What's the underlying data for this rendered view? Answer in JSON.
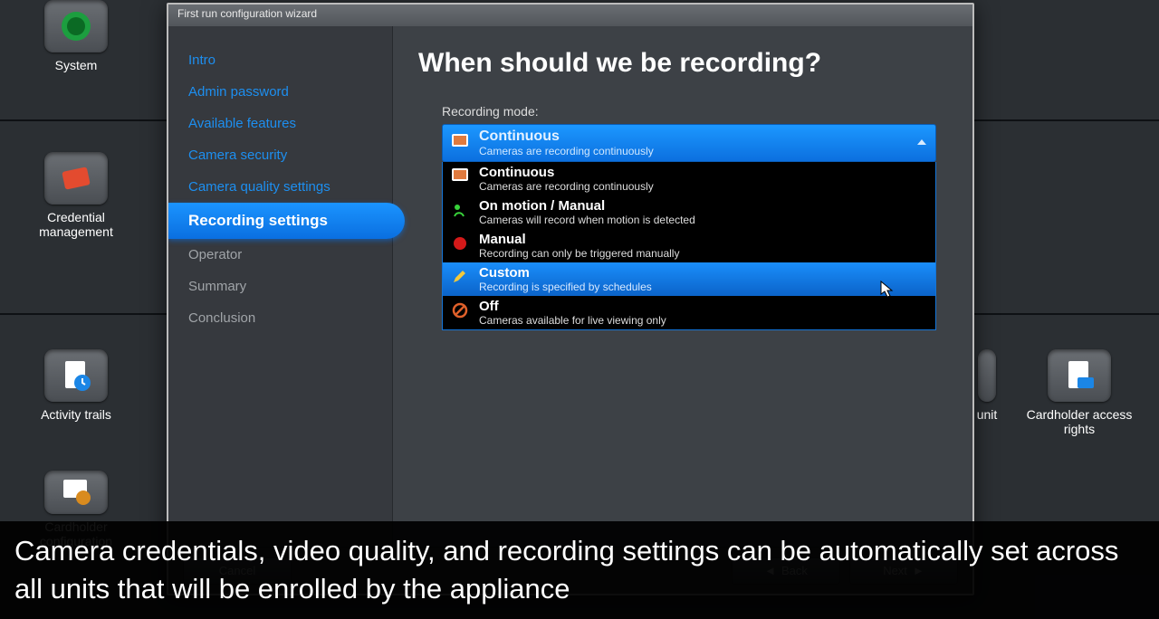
{
  "desktop": {
    "icons": [
      {
        "label": "System"
      },
      {
        "label": "Credential management"
      },
      {
        "label": "Activity trails"
      },
      {
        "label": "Cardholder configuration"
      },
      {
        "label_right_partial": "unit"
      },
      {
        "label_right": "Cardholder access rights"
      }
    ]
  },
  "wizard": {
    "title": "First run configuration wizard",
    "sidebar": [
      {
        "label": "Intro",
        "state": "link"
      },
      {
        "label": "Admin password",
        "state": "link"
      },
      {
        "label": "Available features",
        "state": "link"
      },
      {
        "label": "Camera security",
        "state": "link"
      },
      {
        "label": "Camera quality settings",
        "state": "link"
      },
      {
        "label": "Recording settings",
        "state": "active"
      },
      {
        "label": "Operator",
        "state": "done"
      },
      {
        "label": "Summary",
        "state": "done"
      },
      {
        "label": "Conclusion",
        "state": "done"
      }
    ],
    "heading": "When should we be recording?",
    "field_label": "Recording mode:",
    "selected": {
      "title": "Continuous",
      "desc": "Cameras are recording continuously"
    },
    "options": [
      {
        "title": "Continuous",
        "desc": "Cameras are recording continuously",
        "icon": "film",
        "highlight": false
      },
      {
        "title": "On motion / Manual",
        "desc": "Cameras will record when motion is detected",
        "icon": "motion",
        "highlight": false
      },
      {
        "title": "Manual",
        "desc": "Recording can only be triggered manually",
        "icon": "record",
        "highlight": false
      },
      {
        "title": "Custom",
        "desc": "Recording is specified by schedules",
        "icon": "pencil",
        "highlight": true
      },
      {
        "title": "Off",
        "desc": "Cameras available for live viewing only",
        "icon": "no",
        "highlight": false
      }
    ],
    "buttons": {
      "cancel": "Cancel",
      "back": "Back",
      "next": "Next"
    }
  },
  "caption": "Camera credentials, video quality, and recording settings can be automatically set across all units that will be enrolled by the appliance"
}
